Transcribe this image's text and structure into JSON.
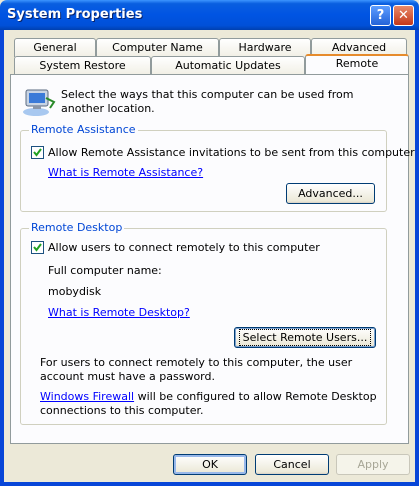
{
  "window": {
    "title": "System Properties",
    "help_label": "?",
    "close_label": "✕"
  },
  "tabs_row1": [
    {
      "label": "General"
    },
    {
      "label": "Computer Name"
    },
    {
      "label": "Hardware"
    },
    {
      "label": "Advanced"
    }
  ],
  "tabs_row2": [
    {
      "label": "System Restore"
    },
    {
      "label": "Automatic Updates"
    },
    {
      "label": "Remote",
      "active": true
    }
  ],
  "intro": "Select the ways that this computer can be used from another location.",
  "remote_assistance": {
    "group_label": "Remote Assistance",
    "checkbox_label": "Allow Remote Assistance invitations to be sent from this computer",
    "checked": true,
    "link": "What is Remote Assistance?",
    "advanced_button": "Advanced..."
  },
  "remote_desktop": {
    "group_label": "Remote Desktop",
    "checkbox_label": "Allow users to connect remotely to this computer",
    "checked": true,
    "full_name_label": "Full computer name:",
    "computer_name": "mobydisk",
    "link": "What is Remote Desktop?",
    "select_users_button": "Select Remote Users...",
    "note_password": "For users to connect remotely to this computer, the user account must have a password.",
    "firewall_link": "Windows Firewall",
    "firewall_text": " will be configured to allow Remote Desktop connections to this computer."
  },
  "buttons": {
    "ok": "OK",
    "cancel": "Cancel",
    "apply": "Apply"
  }
}
